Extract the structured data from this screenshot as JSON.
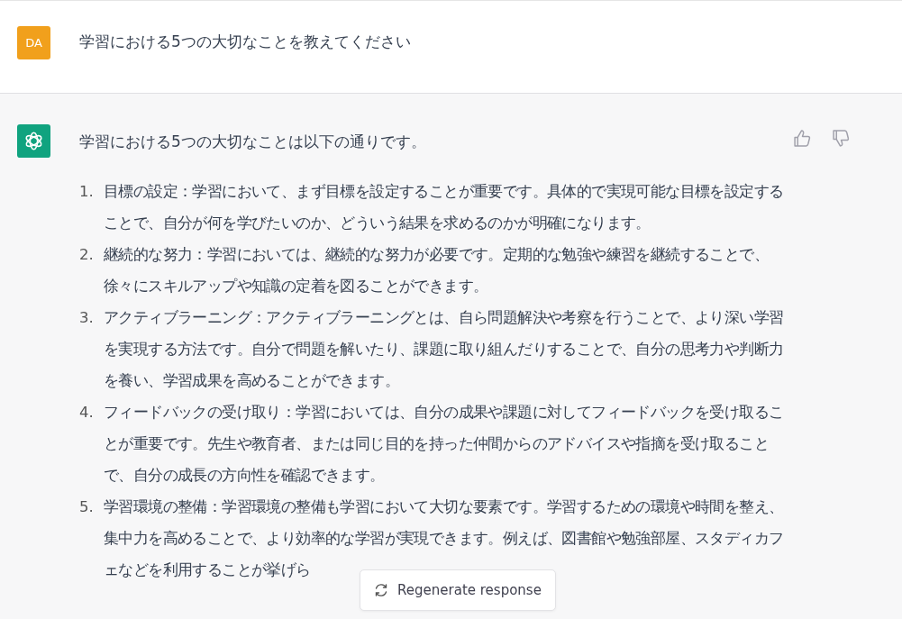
{
  "user_message": {
    "avatar": "DA",
    "text": "学習における5つの大切なことを教えてください"
  },
  "assistant_message": {
    "intro": "学習における5つの大切なことは以下の通りです。",
    "items": [
      {
        "number": "1.",
        "text": "目標の設定：学習において、まず目標を設定することが重要です。具体的で実現可能な目標を設定することで、自分が何を学びたいのか、どういう結果を求めるのかが明確になります。"
      },
      {
        "number": "2.",
        "text": "継続的な努力：学習においては、継続的な努力が必要です。定期的な勉強や練習を継続することで、徐々にスキルアップや知識の定着を図ることができます。"
      },
      {
        "number": "3.",
        "text": "アクティブラーニング：アクティブラーニングとは、自ら問題解決や考察を行うことで、より深い学習を実現する方法です。自分で問題を解いたり、課題に取り組んだりすることで、自分の思考力や判断力を養い、学習成果を高めることができます。"
      },
      {
        "number": "4.",
        "text": "フィードバックの受け取り：学習においては、自分の成果や課題に対してフィードバックを受け取ることが重要です。先生や教育者、または同じ目的を持った仲間からのアドバイスや指摘を受け取ることで、自分の成長の方向性を確認できます。"
      },
      {
        "number": "5.",
        "text": "学習環境の整備：学習環境の整備も学習において大切な要素です。学習するための環境や時間を整え、集中力を高めることで、より効率的な学習が実現できます。例えば、図書館や勉強部屋、スタディカフェなどを利用することが挙げら"
      }
    ]
  },
  "regenerate_button": {
    "label": "Regenerate response"
  }
}
